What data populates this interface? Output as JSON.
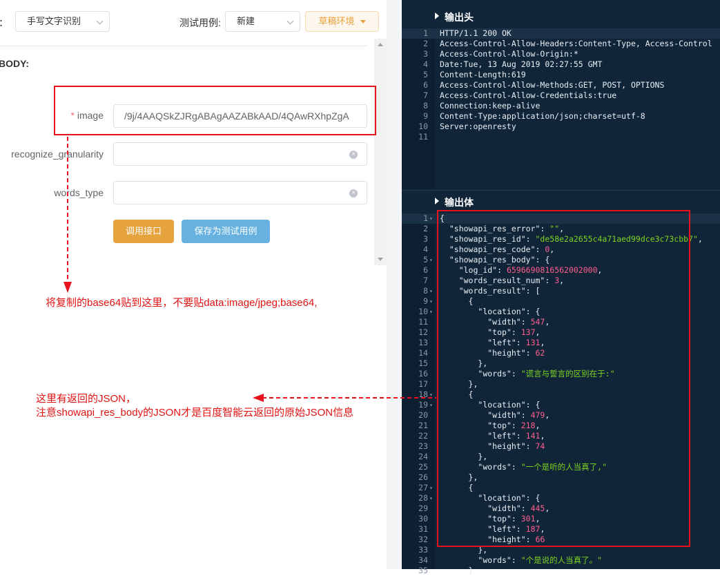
{
  "toolbar": {
    "source_label": "源：",
    "api_select": "手写文字识别",
    "testcase_label": "测试用例:",
    "testcase_select": "新建",
    "env_button": "草稿环境"
  },
  "form": {
    "body_title": "BODY:",
    "required_mark": "*",
    "fields": [
      {
        "label": "image",
        "value": "/9j/4AAQSkZJRgABAgAAZABkAAD/4QAwRXhpZgA"
      },
      {
        "label": "recognize_granularity",
        "value": ""
      },
      {
        "label": "words_type",
        "value": ""
      }
    ],
    "call_button": "调用接口",
    "save_button": "保存为测试用例"
  },
  "annotations": {
    "note1": "将复制的base64贴到这里，不要贴data:image/jpeg;base64,",
    "note2_line1": "这里有返回的JSON，",
    "note2_line2": "注意showapi_res_body的JSON才是百度智能云返回的原始JSON信息"
  },
  "output_head": {
    "title": "输出头",
    "lines": [
      "HTTP/1.1 200 OK",
      "Access-Control-Allow-Headers:Content-Type, Access-Control",
      "Access-Control-Allow-Origin:*",
      "Date:Tue, 13 Aug 2019 02:27:55 GMT",
      "Content-Length:619",
      "Access-Control-Allow-Methods:GET, POST, OPTIONS",
      "Access-Control-Allow-Credentials:true",
      "Connection:keep-alive",
      "Content-Type:application/json;charset=utf-8",
      "Server:openresty",
      ""
    ]
  },
  "output_body": {
    "title": "输出体",
    "lines": [
      "{",
      "  \"showapi_res_error\": \"\",",
      "  \"showapi_res_id\": \"de58e2a2655c4a71aed99dce3c73cbb7\",",
      "  \"showapi_res_code\": 0,",
      "  \"showapi_res_body\": {",
      "    \"log_id\": 6596690816562002000,",
      "    \"words_result_num\": 3,",
      "    \"words_result\": [",
      "      {",
      "        \"location\": {",
      "          \"width\": 547,",
      "          \"top\": 137,",
      "          \"left\": 131,",
      "          \"height\": 62",
      "        },",
      "        \"words\": \"谎言与誓言的区别在于:\"",
      "      },",
      "      {",
      "        \"location\": {",
      "          \"width\": 479,",
      "          \"top\": 218,",
      "          \"left\": 141,",
      "          \"height\": 74",
      "        },",
      "        \"words\": \"一个是听的人当真了,\"",
      "      },",
      "      {",
      "        \"location\": {",
      "          \"width\": 445,",
      "          \"top\": 301,",
      "          \"left\": 187,",
      "          \"height\": 66",
      "        },",
      "        \"words\": \"个是说的人当真了。\"",
      "      }"
    ],
    "fold_lines": [
      1,
      5,
      8,
      9,
      10,
      18,
      19,
      27,
      28
    ]
  }
}
